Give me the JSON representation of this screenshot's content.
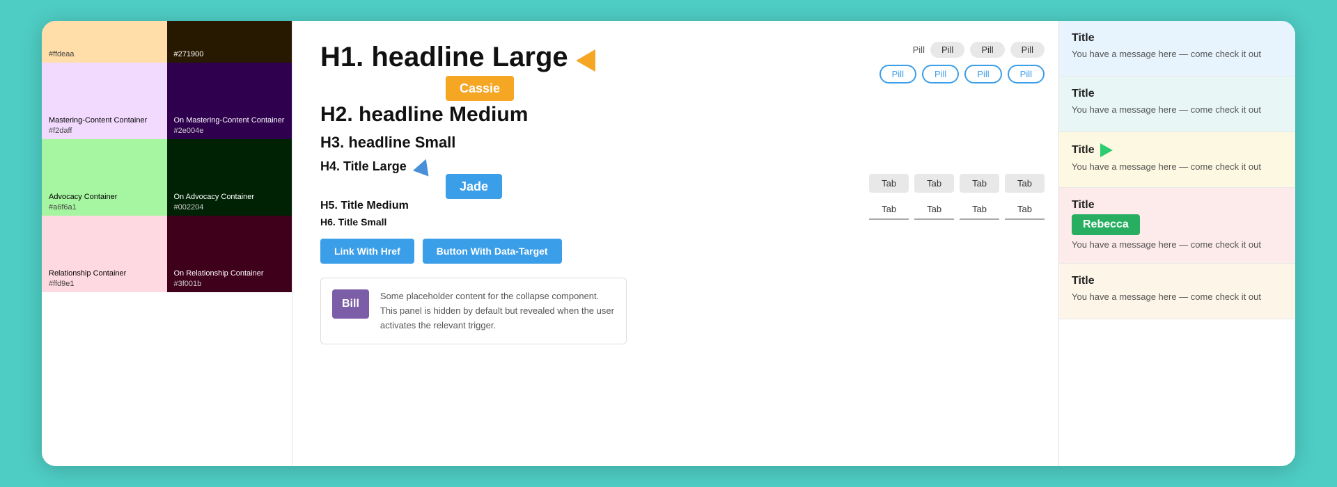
{
  "leftPanel": {
    "topRow": [
      {
        "bg": "#ffdeaa",
        "hex": "#ffdeaa"
      },
      {
        "bg": "#271900",
        "hex": "#271900",
        "textColor": "white"
      }
    ],
    "rows": [
      {
        "cells": [
          {
            "bg": "#f2daff",
            "label": "Mastering-Content Container",
            "hex": "#f2daff"
          },
          {
            "bg": "#2e004e",
            "label": "On Mastering-Content Container",
            "hex": "#2e004e",
            "textColor": "white"
          }
        ]
      },
      {
        "cells": [
          {
            "bg": "#a6f6a1",
            "label": "Advocacy Container",
            "hex": "#a6f6a1"
          },
          {
            "bg": "#002204",
            "label": "On Advocacy Container",
            "hex": "#002204",
            "textColor": "white"
          }
        ]
      },
      {
        "cells": [
          {
            "bg": "#ffd9e1",
            "label": "Relationship Container",
            "hex": "#ffd9e1"
          },
          {
            "bg": "#3f001b",
            "label": "On Relationship Container",
            "hex": "#3f001b",
            "textColor": "white"
          }
        ]
      }
    ]
  },
  "middle": {
    "h1": "H1. headline Large",
    "h2": "H2. headline Medium",
    "h3": "H3. headline Small",
    "h4": "H4. Title Large",
    "h5": "H5. Title Medium",
    "h6": "H6. Title Small",
    "cassie": "Cassie",
    "jade": "Jade",
    "bill": "Bill",
    "pills": {
      "row1": [
        "Pill",
        "Pill",
        "Pill",
        "Pill"
      ],
      "row2": [
        "Pill",
        "Pill",
        "Pill",
        "Pill"
      ]
    },
    "tabs": {
      "row1": [
        "Tab",
        "Tab",
        "Tab",
        "Tab"
      ],
      "row2": [
        "Tab",
        "Tab",
        "Tab",
        "Tab"
      ]
    },
    "btn1": "Link With Href",
    "btn2": "Button With Data-Target",
    "collapseText": "Some placeholder content for the collapse component. This panel is hidden by default but revealed when the user activates the relevant trigger."
  },
  "rightPanel": {
    "cards": [
      {
        "style": "blue",
        "title": "Title",
        "body": "You have a message here — come check it out"
      },
      {
        "style": "teal",
        "title": "Title",
        "body": "You have a message here — come check it out"
      },
      {
        "style": "yellow",
        "title": "Title",
        "body": "You have a message here — come check it out",
        "hasArrow": true
      },
      {
        "style": "pink",
        "title": "Title",
        "body": "You have a message here — come check it out",
        "hasBadge": true,
        "badge": "Rebecca"
      },
      {
        "style": "cream",
        "title": "Title",
        "body": "You have a message here — come check it out"
      }
    ]
  }
}
